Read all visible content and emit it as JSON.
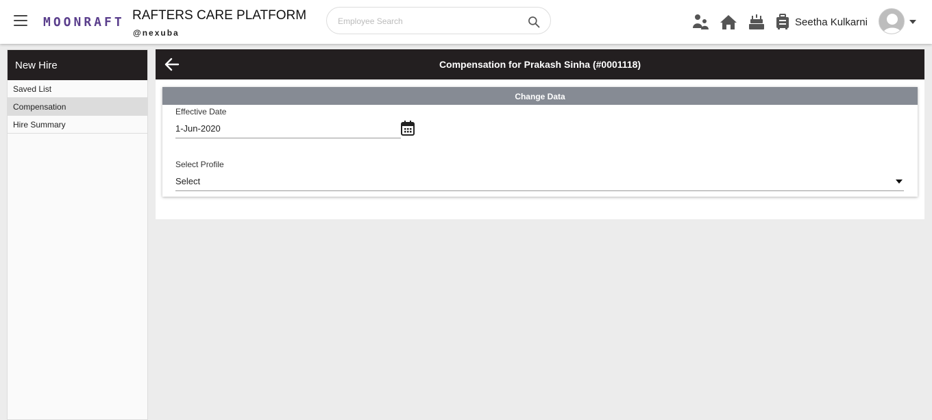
{
  "header": {
    "brand": "MOONRAFT",
    "title": "RAFTERS CARE PLATFORM",
    "subtitle": "@nexuba",
    "search_placeholder": "Employee Search",
    "user_name": "Seetha Kulkarni",
    "icons": [
      "menu-icon",
      "search-icon",
      "family-icon",
      "home-icon",
      "birthday-cake-icon",
      "luggage-icon",
      "avatar",
      "chevron-down-icon"
    ]
  },
  "sidebar": {
    "title": "New Hire",
    "items": [
      {
        "label": "Saved List",
        "active": false
      },
      {
        "label": "Compensation",
        "active": true
      },
      {
        "label": "Hire Summary",
        "active": false
      }
    ]
  },
  "main": {
    "title": "Compensation for Prakash Sinha (#0001118)",
    "card_title": "Change Data",
    "effective_date_label": "Effective Date",
    "effective_date_value": "1-Jun-2020",
    "profile_label": "Select Profile",
    "profile_value": "Select"
  },
  "colors": {
    "header_dark": "#231f20",
    "card_header": "#868b94",
    "brand": "#5a3e8c",
    "active_item": "#dcdcdc"
  }
}
